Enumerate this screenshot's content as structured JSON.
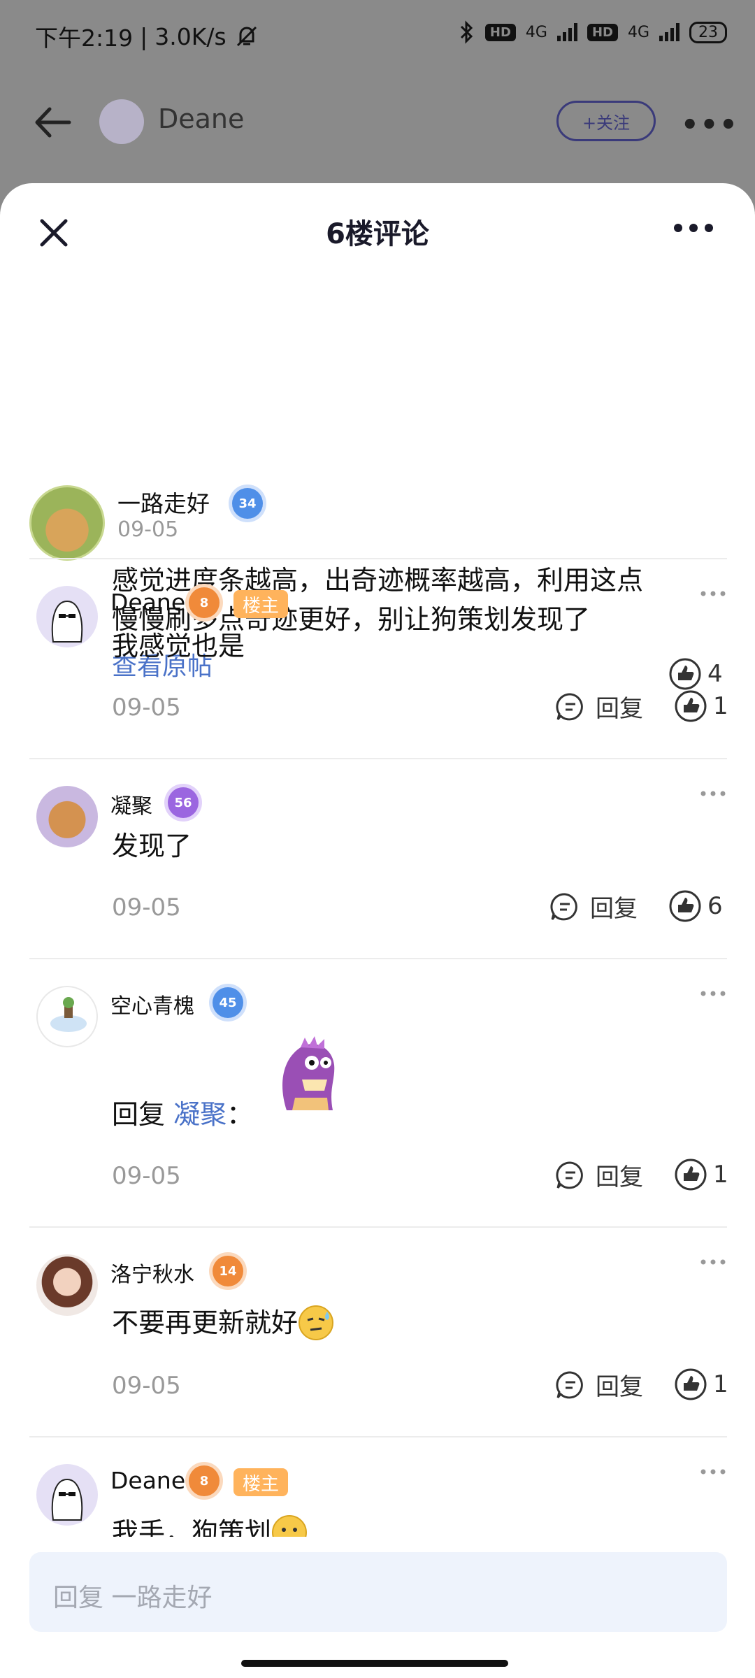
{
  "status_bar": {
    "time": "下午2:19",
    "speed": "3.0K/s",
    "battery": "23",
    "network_1": "4G",
    "network_2": "4G",
    "hd_label": "HD"
  },
  "background_header": {
    "name": "Deane",
    "follow_label": "+关注"
  },
  "sheet": {
    "title": "6楼评论"
  },
  "main_post": {
    "author": "一路走好",
    "level": "34",
    "date": "09-05",
    "content_line1": "感觉进度条越高，出奇迹概率越高，利用这点",
    "content_line2": "慢慢刷多点奇迹更好，别让狗策划发现了",
    "view_original": "查看原帖",
    "likes": "4"
  },
  "comments": [
    {
      "author": "Deane",
      "level": "8",
      "tag": "楼主",
      "text": "我感觉也是",
      "date": "09-05",
      "reply_label": "回复",
      "likes": "1"
    },
    {
      "author": "凝聚",
      "level": "56",
      "text": "发现了",
      "date": "09-05",
      "reply_label": "回复",
      "likes": "6"
    },
    {
      "author": "空心青槐",
      "level": "45",
      "reply_prefix": "回复",
      "reply_to": "凝聚",
      "colon": "：",
      "date": "09-05",
      "reply_label": "回复",
      "likes": "1"
    },
    {
      "author": "洛宁秋水",
      "level": "14",
      "text": "不要再更新就好",
      "date": "09-05",
      "reply_label": "回复",
      "likes": "1"
    },
    {
      "author": "Deane",
      "level": "8",
      "tag": "楼主",
      "text": "我手，狗策划"
    }
  ],
  "reply_input": {
    "placeholder": "回复 一路走好"
  },
  "icons": {
    "back": "back-arrow-icon",
    "close": "close-icon",
    "more": "more-dots-icon",
    "like": "thumbs-up-icon",
    "reply": "comment-bubble-icon",
    "bluetooth": "bluetooth-icon",
    "mute": "bell-mute-icon"
  },
  "colors": {
    "accent_link": "#4a72c8",
    "owner_tag": "#ffb35c",
    "reply_bar_bg": "#eef3fc"
  }
}
